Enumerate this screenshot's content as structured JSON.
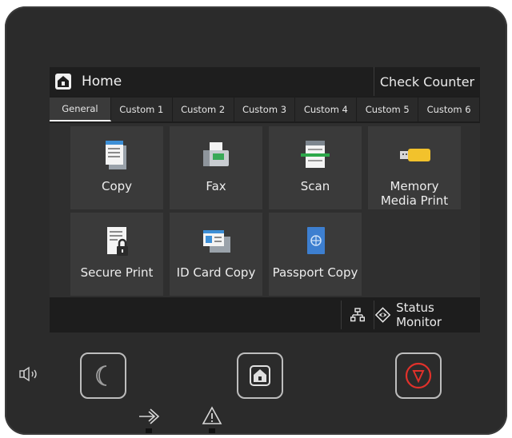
{
  "header": {
    "title": "Home",
    "check_counter": "Check Counter"
  },
  "tabs": [
    "General",
    "Custom 1",
    "Custom 2",
    "Custom 3",
    "Custom 4",
    "Custom 5",
    "Custom 6"
  ],
  "active_tab": "General",
  "tiles": [
    {
      "label": "Copy",
      "icon": "copy-icon"
    },
    {
      "label": "Fax",
      "icon": "fax-icon"
    },
    {
      "label": "Scan",
      "icon": "scan-icon"
    },
    {
      "label": "Memory\nMedia Print",
      "icon": "usb-memory-icon"
    },
    {
      "label": "Secure Print",
      "icon": "secure-print-icon"
    },
    {
      "label": "ID Card Copy",
      "icon": "id-card-icon"
    },
    {
      "label": "Passport Copy",
      "icon": "passport-icon"
    }
  ],
  "status": {
    "monitor_label": "Status Monitor"
  },
  "icons": {
    "home": "home-icon",
    "network": "network-icon",
    "status": "eye-icon",
    "sleep": "moon-icon",
    "stop": "stop-icon",
    "volume": "speaker-icon",
    "data": "data-arrow-icon",
    "error": "warning-icon"
  },
  "colors": {
    "stop": "#e0312b",
    "scan_green": "#2ea84a",
    "usb_yellow": "#f2c22c"
  }
}
